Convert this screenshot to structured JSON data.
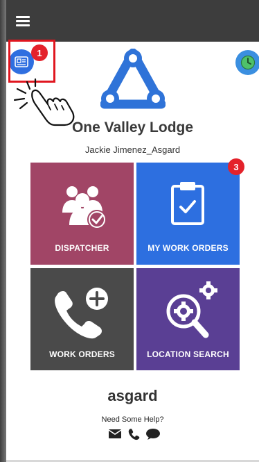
{
  "topbar": {
    "menu_icon": "hamburger-menu-icon"
  },
  "id_button": {
    "icon": "id-card-icon",
    "badge": "1",
    "accent": "#2f6fe0"
  },
  "clock_button": {
    "icon": "clock-icon",
    "accent": "#3b8fe0"
  },
  "header": {
    "logo_icon": "tri-circle-logo",
    "lodge_name": "One Valley Lodge",
    "user_name": "Jackie Jimenez_Asgard"
  },
  "tiles": [
    {
      "label": "DISPATCHER",
      "icon": "people-check-icon",
      "color": "#a14566"
    },
    {
      "label": "MY WORK ORDERS",
      "icon": "clipboard-check-icon",
      "color": "#2d6fe0",
      "badge": "3"
    },
    {
      "label": "WORK ORDERS",
      "icon": "phone-plus-icon",
      "color": "#4a4a4a"
    },
    {
      "label": "LOCATION SEARCH",
      "icon": "gear-search-icon",
      "color": "#5a3f94"
    }
  ],
  "footer": {
    "app_name": "asgard",
    "help_text": "Need Some Help?",
    "help_icons": [
      "envelope-icon",
      "phone-icon",
      "chat-icon"
    ]
  }
}
